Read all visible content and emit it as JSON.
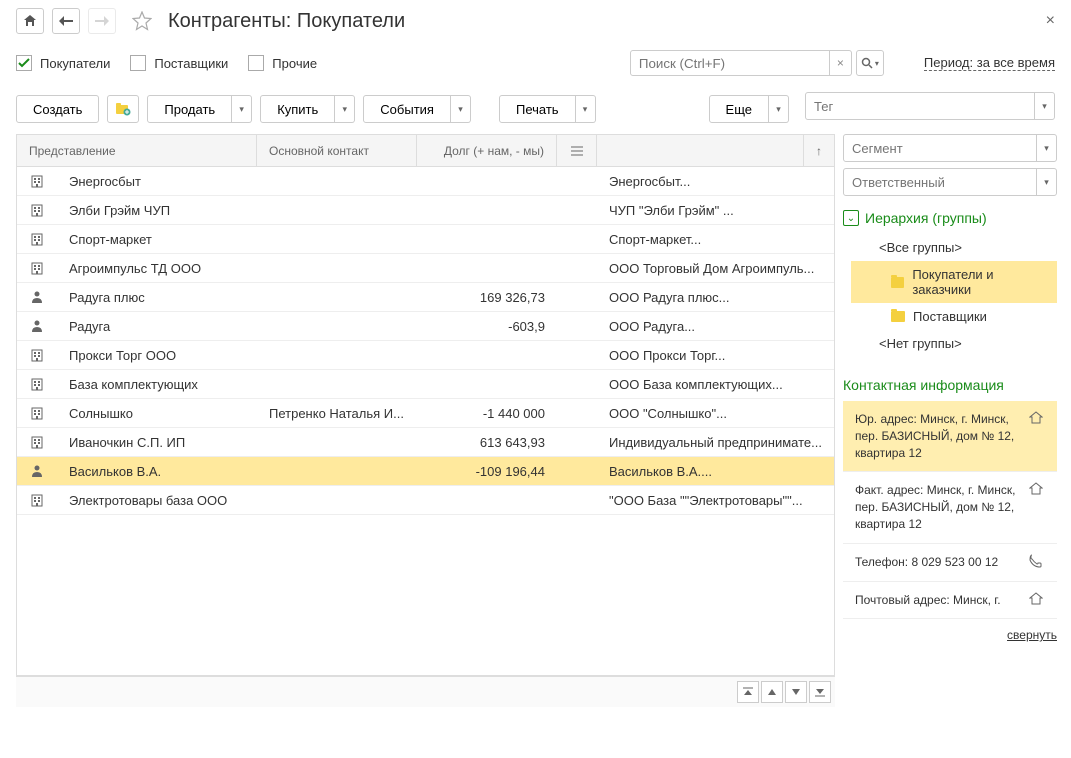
{
  "header": {
    "title": "Контрагенты: Покупатели"
  },
  "filters": {
    "buyers": {
      "label": "Покупатели",
      "checked": true
    },
    "suppliers": {
      "label": "Поставщики",
      "checked": false
    },
    "others": {
      "label": "Прочие",
      "checked": false
    }
  },
  "search": {
    "placeholder": "Поиск (Ctrl+F)"
  },
  "period": {
    "label": "Период: за все время"
  },
  "toolbar": {
    "create": "Создать",
    "sell": "Продать",
    "buy": "Купить",
    "events": "События",
    "print": "Печать",
    "more": "Еще"
  },
  "sidebar_filters": {
    "tag": "Тег",
    "segment": "Сегмент",
    "responsible": "Ответственный"
  },
  "columns": {
    "name": "Представление",
    "contact": "Основной контакт",
    "debt": "Долг (+ нам, - мы)"
  },
  "rows": [
    {
      "icon": "building",
      "name": "Энергосбыт",
      "contact": "",
      "debt": "",
      "descr": "Энергосбыт...",
      "selected": false
    },
    {
      "icon": "building",
      "name": "Элби Грэйм ЧУП",
      "contact": "",
      "debt": "",
      "descr": "ЧУП \"Элби Грэйм\" ...",
      "selected": false
    },
    {
      "icon": "building",
      "name": "Спорт-маркет",
      "contact": "",
      "debt": "",
      "descr": "Спорт-маркет...",
      "selected": false
    },
    {
      "icon": "building",
      "name": "Агроимпульс ТД ООО",
      "contact": "",
      "debt": "",
      "descr": "ООО Торговый Дом Агроимпуль...",
      "selected": false
    },
    {
      "icon": "person",
      "name": "Радуга плюс",
      "contact": "",
      "debt": "169 326,73",
      "descr": "ООО Радуга плюс...",
      "selected": false
    },
    {
      "icon": "person",
      "name": "Радуга",
      "contact": "",
      "debt": "-603,9",
      "descr": "ООО Радуга...",
      "selected": false
    },
    {
      "icon": "building",
      "name": "Прокси Торг ООО",
      "contact": "",
      "debt": "",
      "descr": "ООО Прокси Торг...",
      "selected": false
    },
    {
      "icon": "building",
      "name": "База комплектующих",
      "contact": "",
      "debt": "",
      "descr": "ООО База комплектующих...",
      "selected": false
    },
    {
      "icon": "building",
      "name": "Солнышко",
      "contact": "Петренко Наталья И...",
      "debt": "-1 440 000",
      "descr": "ООО \"Солнышко\"...",
      "selected": false
    },
    {
      "icon": "building",
      "name": "Иваночкин С.П. ИП",
      "contact": "",
      "debt": "613 643,93",
      "descr": "Индивидуальный предпринимате...",
      "selected": false
    },
    {
      "icon": "person",
      "name": "Васильков В.А.",
      "contact": "",
      "debt": "-109 196,44",
      "descr": "Васильков В.А....",
      "selected": true
    },
    {
      "icon": "building",
      "name": "Электротовары база ООО",
      "contact": "",
      "debt": "",
      "descr": "\"ООО База \"\"Электротовары\"\"...",
      "selected": false
    }
  ],
  "hierarchy": {
    "title": "Иерархия (группы)",
    "all_groups": "<Все группы>",
    "buyers_customers": "Покупатели и заказчики",
    "suppliers": "Поставщики",
    "no_group": "<Нет группы>"
  },
  "contact_info": {
    "title": "Контактная информация",
    "items": [
      {
        "text": "Юр. адрес: Минск, г. Минск, пер. БАЗИСНЫЙ, дом № 12, квартира 12",
        "icon": "home",
        "selected": true
      },
      {
        "text": "Факт. адрес: Минск, г. Минск, пер. БАЗИСНЫЙ, дом № 12, квартира 12",
        "icon": "home",
        "selected": false
      },
      {
        "text": "Телефон: 8 029 523 00 12",
        "icon": "phone",
        "selected": false
      },
      {
        "text": "Почтовый адрес: Минск, г.",
        "icon": "home",
        "selected": false
      }
    ],
    "collapse": "свернуть"
  }
}
